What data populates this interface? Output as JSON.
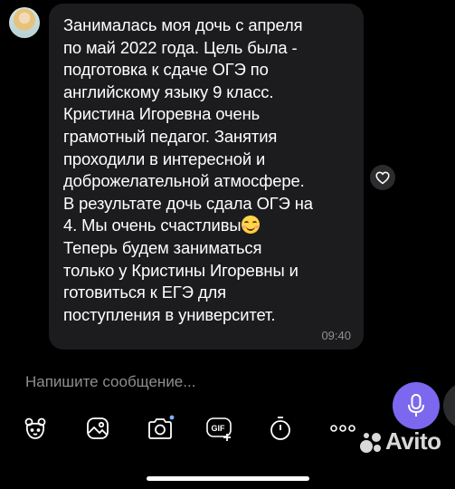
{
  "message": {
    "lines": [
      "Занималась моя дочь с апреля",
      "по май 2022 года. Цель была -",
      "подготовка к сдаче ОГЭ по",
      "английскому языку 9 класс.",
      "Кристина Игоревна очень",
      "грамотный педагог. Занятия",
      "проходили в интересной и",
      "доброжелательной атмосфере.",
      "В результате дочь сдала ОГЭ на",
      "4. Мы очень счастливы",
      "Теперь будем заниматься",
      "только у Кристины Игоревны и",
      "готовиться к ЕГЭ для",
      "поступления в университет."
    ],
    "emoji": "smiling-face-emoji",
    "time": "09:40"
  },
  "composer": {
    "placeholder": "Напишите сообщение..."
  },
  "toolbar": {
    "icons": [
      "sticker-icon",
      "image-icon",
      "camera-icon",
      "gif-icon",
      "timer-icon",
      "more-icon"
    ],
    "gif_label": "GIF"
  },
  "watermark": {
    "text": "Avito"
  },
  "colors": {
    "bubble": "#1c1c1e",
    "accent": "#7b68ee",
    "muted": "#8e8e93"
  }
}
